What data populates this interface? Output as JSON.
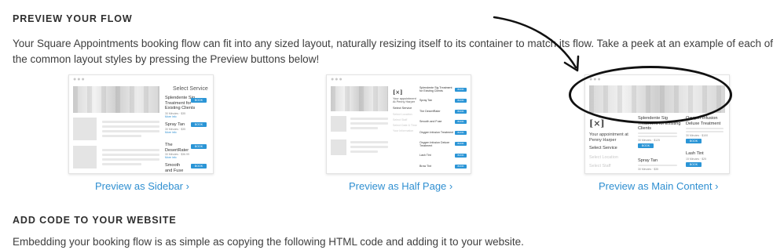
{
  "preview_section": {
    "heading": "PREVIEW YOUR FLOW",
    "description": "Your Square Appointments booking flow can fit into any sized layout, naturally resizing itself to its container to match its flow. Take a peek at an example of each of the common layout styles by pressing the Preview buttons below!",
    "previews": [
      {
        "link_label": "Preview as Sidebar ›",
        "mock": {
          "select_service": "Select Service",
          "services": [
            {
              "name": "Splendente Sig Treatment for Existing Clients",
              "meta": "30 Minutes · $35",
              "more": "More info",
              "book": "BOOK NOW"
            },
            {
              "name": "Spray Tan",
              "meta": "30 Minutes · $35",
              "more": "More info",
              "book": "BOOK NOW"
            },
            {
              "name": "The DesertRater",
              "meta": "30 Minutes · $36.99",
              "more": "More info",
              "book": "BOOK NOW"
            },
            {
              "name": "Smooth and Fuse",
              "meta": "",
              "more": "",
              "book": "BOOK NOW"
            }
          ]
        }
      },
      {
        "link_label": "Preview as Half Page ›",
        "mock": {
          "logo": "[×]",
          "appointment": "Your appointment",
          "staff": "At Penny Harper",
          "select_service": "Select Service",
          "muted_steps": [
            "Select Location",
            "Select Staff",
            "Select Date & Time",
            "Your Information"
          ],
          "services": [
            {
              "name": "Splendente Sig Treatment for Existing Clients",
              "book": "BOOK NOW"
            },
            {
              "name": "Spray Tan",
              "book": "BOOK NOW"
            },
            {
              "name": "The DesertRater",
              "book": "BOOK NOW"
            },
            {
              "name": "Smooth and Fuse",
              "book": "BOOK NOW"
            },
            {
              "name": "Oxygen Infusion Treatment",
              "book": "BOOK NOW"
            },
            {
              "name": "Oxygen Infusion Deluxe Treatment",
              "book": "BOOK NOW"
            },
            {
              "name": "Lash Tint",
              "book": "BOOK NOW"
            },
            {
              "name": "Brow Tint",
              "book": "BOOK NOW"
            }
          ]
        }
      },
      {
        "link_label": "Preview as Main Content ›",
        "mock": {
          "logo": "[×]",
          "appointment": "Your appointment at Penny Harper",
          "select_service": "Select Service",
          "muted_steps": [
            "Select Location",
            "Select Staff"
          ],
          "services_left": [
            {
              "name": "Splendente Sig Treatment for Existing Clients",
              "meta": "30 Minutes · $125",
              "book": "BOOK NOW"
            },
            {
              "name": "Spray Tan",
              "meta": "30 Minutes · $35",
              "book": "BOOK NOW"
            }
          ],
          "services_right": [
            {
              "name": "Oxygen Infusion Deluxe Treatment",
              "meta": "30 Minutes · $100",
              "book": "BOOK NOW"
            },
            {
              "name": "Lash Tint",
              "meta": "15 Minutes · $25",
              "book": "BOOK NOW"
            }
          ]
        }
      }
    ]
  },
  "code_section": {
    "heading": "ADD CODE TO YOUR WEBSITE",
    "description": "Embedding your booking flow is as simple as copying the following HTML code and adding it to your website."
  },
  "colors": {
    "link": "#2f8fd1",
    "book_button": "#2b95d6",
    "annotation": "#111111"
  }
}
